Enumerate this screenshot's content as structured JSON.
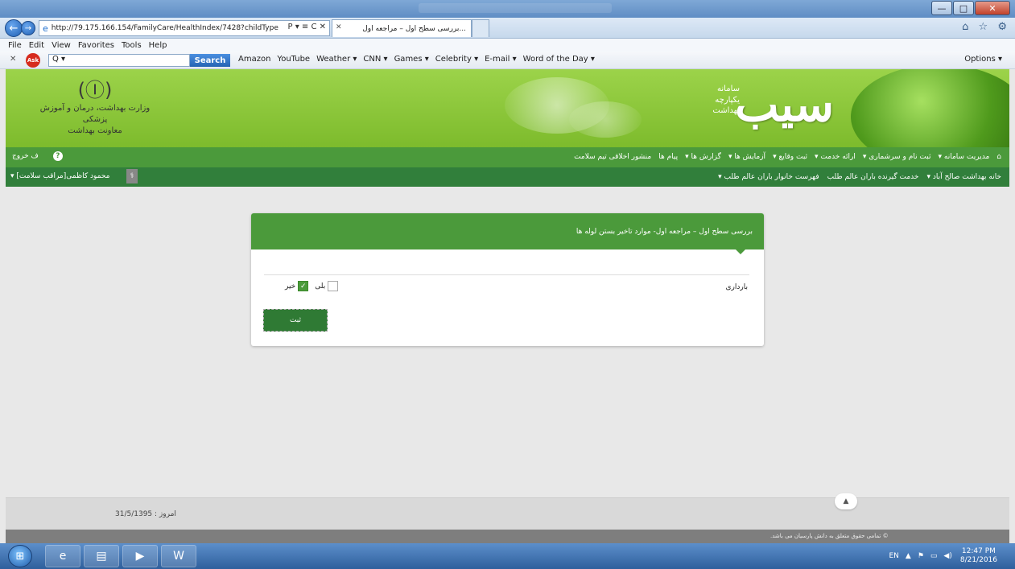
{
  "browser": {
    "url": "http://79.175.166.154/FamilyCare/HealthIndex/7428?childType",
    "addr_tools": "Ρ ▾ ≡ C ✕",
    "tab_title": "...بررسی سطح اول – مراجعه اول",
    "nav_right_icons": "⌂ ☆ ⚙"
  },
  "menubar": [
    "File",
    "Edit",
    "View",
    "Favorites",
    "Tools",
    "Help"
  ],
  "toolbar": {
    "search_placeholder": "Q ▾",
    "search_label": "Search",
    "links": [
      "Amazon",
      "YouTube",
      "Weather ▾",
      "CNN ▾",
      "Games ▾",
      "Celebrity ▾",
      "E-mail ▾",
      "Word of the Day ▾"
    ],
    "options_label": "Options ▾"
  },
  "banner": {
    "ministry_lines": [
      "وزارت بهداشت، درمان و آموزش پزشکی",
      "معاونت بهداشت"
    ],
    "brand": "سیب",
    "brand_sub": [
      "سامانه",
      "یکپارچه",
      "بهداشت"
    ]
  },
  "top_menu": {
    "items": [
      "⌂",
      "مدیریت سامانه ▾",
      "ثبت نام و سرشماری ▾",
      "ارائه خدمت ▾",
      "ثبت وقایع ▾",
      "آزمایش ها ▾",
      "گزارش ها ▾",
      "پیام ها",
      "منشور اخلاقی تیم سلامت"
    ],
    "logout": "ف خروج",
    "help": "?"
  },
  "sub_menu": {
    "items": [
      "خانه بهداشت صالح آباد ▾",
      "خدمت گیرنده باران عالم طلب",
      "فهرست خانوار باران عالم طلب ▾"
    ],
    "user": "محمود کاظمی[مراقب سلامت] ▾"
  },
  "card": {
    "title": "بررسی سطح اول – مراجعه اول- موارد تاخیر بستن لوله ها",
    "question": "بارداری",
    "options": [
      {
        "label": "بلی",
        "checked": false
      },
      {
        "label": "خیر",
        "checked": true
      }
    ],
    "submit_label": "ثبت"
  },
  "footer": {
    "today_label": "امروز :",
    "today_value": "31/5/1395",
    "copyright": "© تمامی حقوق متعلق به دانش پارسیان می باشد."
  },
  "taskbar": {
    "lang": "EN",
    "time": "12:47 PM",
    "date": "8/21/2016"
  },
  "colors": {
    "primary_green": "#4b9a3b",
    "dark_green": "#317f3b",
    "banner_green": "#8cc63f"
  }
}
